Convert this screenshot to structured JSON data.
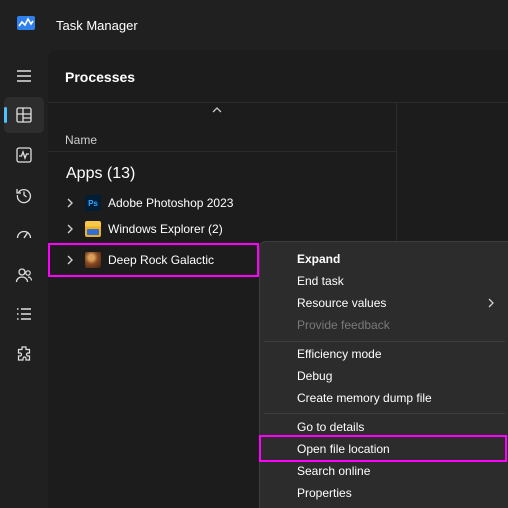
{
  "window": {
    "title": "Task Manager",
    "icon": "task-manager-icon"
  },
  "nav": {
    "items": [
      {
        "name": "hamburger-menu-icon",
        "active": false
      },
      {
        "name": "processes-icon",
        "active": true
      },
      {
        "name": "performance-icon",
        "active": false
      },
      {
        "name": "app-history-icon",
        "active": false
      },
      {
        "name": "startup-apps-icon",
        "active": false
      },
      {
        "name": "users-icon",
        "active": false
      },
      {
        "name": "details-icon",
        "active": false
      },
      {
        "name": "services-icon",
        "active": false
      }
    ]
  },
  "page": {
    "title": "Processes",
    "column_name": "Name",
    "group_title": "Apps (13)"
  },
  "processes": [
    {
      "name": "Adobe Photoshop 2023",
      "icon": "photoshop-icon",
      "icon_text": "Ps"
    },
    {
      "name": "Windows Explorer (2)",
      "icon": "folder-icon"
    },
    {
      "name": "Deep Rock Galactic",
      "icon": "game-icon"
    }
  ],
  "context_menu": {
    "items": [
      {
        "label": "Expand",
        "bold": true
      },
      {
        "label": "End task"
      },
      {
        "label": "Resource values",
        "submenu": true
      },
      {
        "label": "Provide feedback",
        "disabled": true
      },
      {
        "label": "Efficiency mode"
      },
      {
        "label": "Debug"
      },
      {
        "label": "Create memory dump file"
      },
      {
        "label": "Go to details"
      },
      {
        "label": "Open file location"
      },
      {
        "label": "Search online"
      },
      {
        "label": "Properties"
      }
    ]
  },
  "colors": {
    "highlight": "#ff00ff",
    "accent": "#4cc2ff"
  }
}
